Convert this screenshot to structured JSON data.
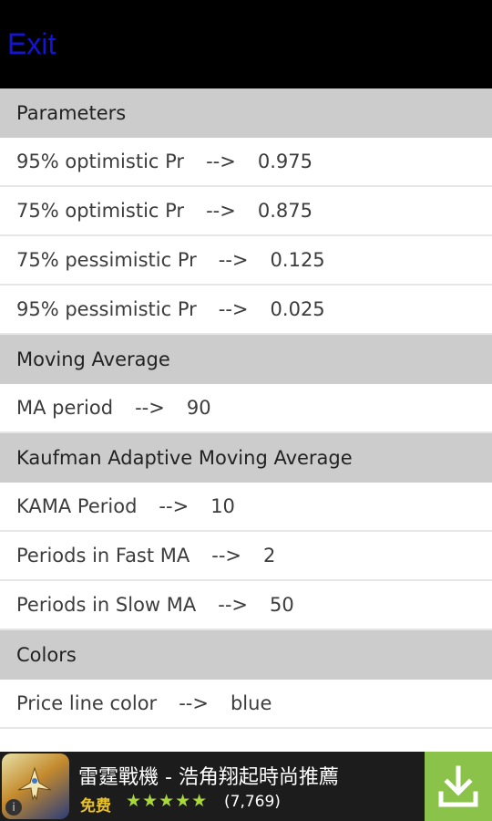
{
  "topbar": {
    "exit_label": "Exit"
  },
  "sections": [
    {
      "header": "Parameters",
      "items": [
        {
          "name": "95% optimistic Pr",
          "arrow": "-->",
          "value": "0.975"
        },
        {
          "name": "75% optimistic Pr",
          "arrow": "-->",
          "value": "0.875"
        },
        {
          "name": "75% pessimistic Pr",
          "arrow": "-->",
          "value": "0.125"
        },
        {
          "name": "95% pessimistic Pr",
          "arrow": "-->",
          "value": "0.025"
        }
      ]
    },
    {
      "header": "Moving Average",
      "items": [
        {
          "name": "MA period",
          "arrow": "-->",
          "value": "90"
        }
      ]
    },
    {
      "header": "Kaufman Adaptive Moving Average",
      "items": [
        {
          "name": "KAMA Period",
          "arrow": "-->",
          "value": "10"
        },
        {
          "name": "Periods in Fast MA",
          "arrow": "-->",
          "value": "2"
        },
        {
          "name": "Periods in Slow MA",
          "arrow": "-->",
          "value": "50"
        }
      ]
    },
    {
      "header": "Colors",
      "items": [
        {
          "name": "Price line color",
          "arrow": "-->",
          "value": "blue"
        }
      ]
    }
  ],
  "ad": {
    "title": "雷霆戰機 - 浩角翔起時尚推薦",
    "price": "免费",
    "stars": "★★★★★",
    "rating_fraction": 0.9,
    "review_count": "(7,769)",
    "icon": "game-icon",
    "download_icon": "download-icon"
  },
  "colors": {
    "topbar": "#000000",
    "exit": "#1414d2",
    "section_header": "#cccccc",
    "download_bg": "#8bc34a"
  }
}
